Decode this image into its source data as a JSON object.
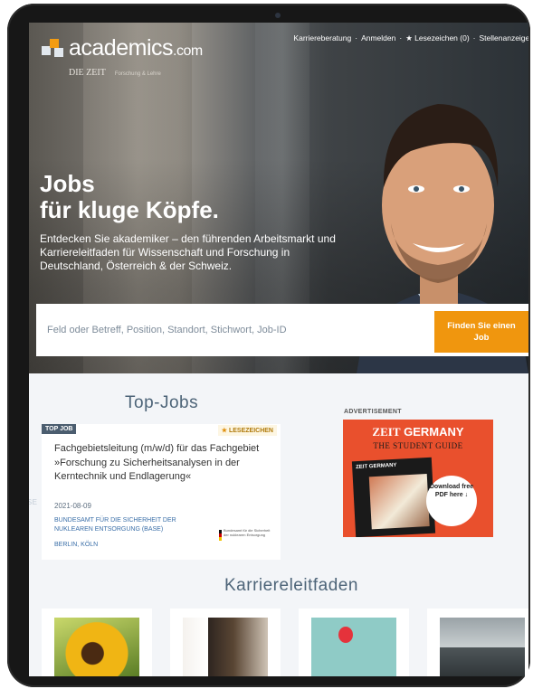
{
  "header": {
    "logo_text": "academics",
    "logo_tld": ".com",
    "logo_partner": "DIE ZEIT",
    "logo_partner_tag": "Forschung & Lehre",
    "nav": [
      "Karriereberatung",
      "·",
      "Anmelden",
      "·",
      "★ Lesezeichen (0)",
      "·",
      "Stellenanzeigen"
    ]
  },
  "hero": {
    "headline_line1": "Jobs",
    "headline_line2": "für kluge Köpfe.",
    "subline": "Entdecken Sie akademiker – den führenden Arbeitsmarkt und Karriereleitfaden für Wissenschaft und Forschung in Deutschland, Österreich & der Schweiz."
  },
  "search": {
    "placeholder": "Feld oder Betreff, Position, Standort, Stichwort, Job-ID",
    "button_label": "Finden Sie einen Job"
  },
  "top_jobs": {
    "title": "Top-Jobs",
    "card": {
      "badge": "TOP JOB",
      "bookmark": "LESEZEICHEN",
      "title": "Fachgebietsleitung (m/w/d) für das Fachgebiet »Forschung zu Sicherheitsanalysen in der Kerntechnik und Endlagerung«",
      "date": "2021-08-09",
      "org": "BUNDESAMT FÜR DIE SICHERHEIT DER NUKLEAREN ENTSORGUNG (BASE)",
      "location": "BERLIN, KÖLN",
      "org_logo_text": "Bundesamt für die Sicherheit der nuklearen Entsorgung"
    },
    "faded_text": "ESE"
  },
  "advertisement": {
    "label": "ADVERTISEMENT",
    "headline_a": "ZEIT",
    "headline_b": "GERMANY",
    "sub": "THE STUDENT GUIDE",
    "book_title": "ZEIT GERMANY",
    "cta": "Download free PDF here ↓"
  },
  "career": {
    "title": "Karriereleitfaden"
  }
}
